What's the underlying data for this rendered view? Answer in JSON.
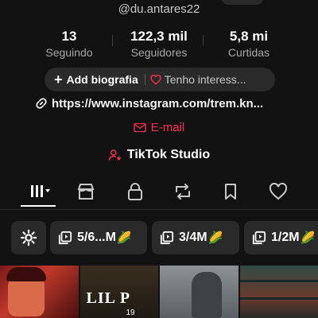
{
  "profile": {
    "handle": "@du.antares22",
    "stats": [
      {
        "value": "13",
        "label": "Seguindo"
      },
      {
        "value": "122,3 mil",
        "label": "Seguidores"
      },
      {
        "value": "5,8 mi",
        "label": "Curtidas"
      }
    ],
    "add_bio_label": "Add biografia",
    "interests_label": "Tenho interess...",
    "link": "https://www.instagram.com/trem.kn...",
    "email_label": "E-mail",
    "studio_label": "TikTok Studio"
  },
  "tabs": [
    {
      "icon": "grid-icon",
      "active": true
    },
    {
      "icon": "shop-icon",
      "active": false
    },
    {
      "icon": "lock-icon",
      "active": false
    },
    {
      "icon": "repost-icon",
      "active": false
    },
    {
      "icon": "bookmark-icon",
      "active": false
    },
    {
      "icon": "heart-icon",
      "active": false
    }
  ],
  "playlists": [
    {
      "label": "5/6...M",
      "emoji": "🌽"
    },
    {
      "label": "3/4M",
      "emoji": "🌽"
    },
    {
      "label": "1/2M",
      "emoji": "🌽"
    }
  ],
  "thumbnails": {
    "second_text": "LIL P",
    "second_subtext": "19"
  },
  "colors": {
    "background": "#121212",
    "accent": "#fe2c55",
    "chip": "#2a2a2a"
  }
}
